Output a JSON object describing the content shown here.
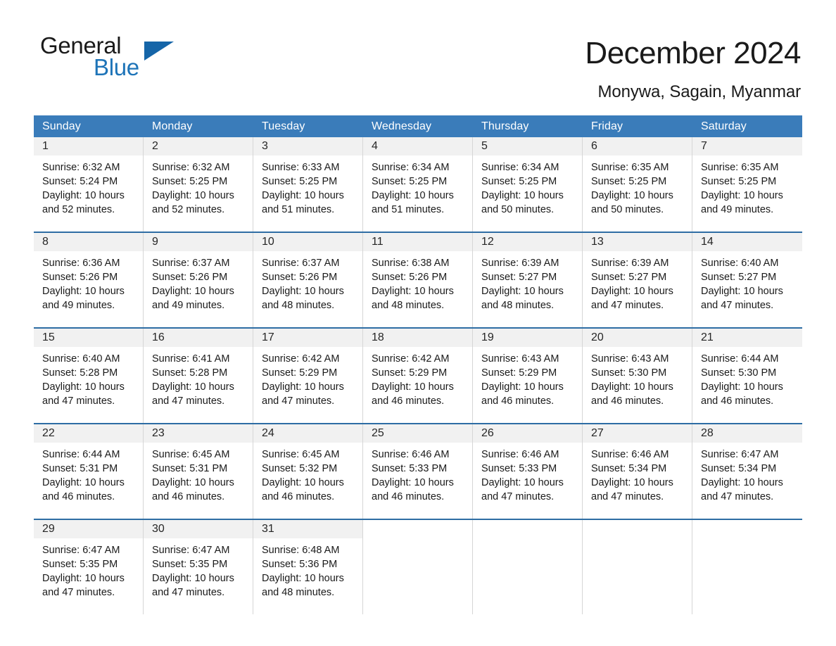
{
  "brand": {
    "name_part1": "General",
    "name_part2": "Blue",
    "triangle_color": "#1565a8",
    "blue_color": "#1e74b8"
  },
  "header": {
    "month_title": "December 2024",
    "location": "Monywa, Sagain, Myanmar"
  },
  "calendar": {
    "header_bg": "#3a7cba",
    "row_divider_color": "#2e6da4",
    "daynum_band_bg": "#f1f1f1",
    "weekdays": [
      "Sunday",
      "Monday",
      "Tuesday",
      "Wednesday",
      "Thursday",
      "Friday",
      "Saturday"
    ],
    "weeks": [
      [
        {
          "day": "1",
          "sunrise": "Sunrise: 6:32 AM",
          "sunset": "Sunset: 5:24 PM",
          "daylight_line1": "Daylight: 10 hours",
          "daylight_line2": "and 52 minutes."
        },
        {
          "day": "2",
          "sunrise": "Sunrise: 6:32 AM",
          "sunset": "Sunset: 5:25 PM",
          "daylight_line1": "Daylight: 10 hours",
          "daylight_line2": "and 52 minutes."
        },
        {
          "day": "3",
          "sunrise": "Sunrise: 6:33 AM",
          "sunset": "Sunset: 5:25 PM",
          "daylight_line1": "Daylight: 10 hours",
          "daylight_line2": "and 51 minutes."
        },
        {
          "day": "4",
          "sunrise": "Sunrise: 6:34 AM",
          "sunset": "Sunset: 5:25 PM",
          "daylight_line1": "Daylight: 10 hours",
          "daylight_line2": "and 51 minutes."
        },
        {
          "day": "5",
          "sunrise": "Sunrise: 6:34 AM",
          "sunset": "Sunset: 5:25 PM",
          "daylight_line1": "Daylight: 10 hours",
          "daylight_line2": "and 50 minutes."
        },
        {
          "day": "6",
          "sunrise": "Sunrise: 6:35 AM",
          "sunset": "Sunset: 5:25 PM",
          "daylight_line1": "Daylight: 10 hours",
          "daylight_line2": "and 50 minutes."
        },
        {
          "day": "7",
          "sunrise": "Sunrise: 6:35 AM",
          "sunset": "Sunset: 5:25 PM",
          "daylight_line1": "Daylight: 10 hours",
          "daylight_line2": "and 49 minutes."
        }
      ],
      [
        {
          "day": "8",
          "sunrise": "Sunrise: 6:36 AM",
          "sunset": "Sunset: 5:26 PM",
          "daylight_line1": "Daylight: 10 hours",
          "daylight_line2": "and 49 minutes."
        },
        {
          "day": "9",
          "sunrise": "Sunrise: 6:37 AM",
          "sunset": "Sunset: 5:26 PM",
          "daylight_line1": "Daylight: 10 hours",
          "daylight_line2": "and 49 minutes."
        },
        {
          "day": "10",
          "sunrise": "Sunrise: 6:37 AM",
          "sunset": "Sunset: 5:26 PM",
          "daylight_line1": "Daylight: 10 hours",
          "daylight_line2": "and 48 minutes."
        },
        {
          "day": "11",
          "sunrise": "Sunrise: 6:38 AM",
          "sunset": "Sunset: 5:26 PM",
          "daylight_line1": "Daylight: 10 hours",
          "daylight_line2": "and 48 minutes."
        },
        {
          "day": "12",
          "sunrise": "Sunrise: 6:39 AM",
          "sunset": "Sunset: 5:27 PM",
          "daylight_line1": "Daylight: 10 hours",
          "daylight_line2": "and 48 minutes."
        },
        {
          "day": "13",
          "sunrise": "Sunrise: 6:39 AM",
          "sunset": "Sunset: 5:27 PM",
          "daylight_line1": "Daylight: 10 hours",
          "daylight_line2": "and 47 minutes."
        },
        {
          "day": "14",
          "sunrise": "Sunrise: 6:40 AM",
          "sunset": "Sunset: 5:27 PM",
          "daylight_line1": "Daylight: 10 hours",
          "daylight_line2": "and 47 minutes."
        }
      ],
      [
        {
          "day": "15",
          "sunrise": "Sunrise: 6:40 AM",
          "sunset": "Sunset: 5:28 PM",
          "daylight_line1": "Daylight: 10 hours",
          "daylight_line2": "and 47 minutes."
        },
        {
          "day": "16",
          "sunrise": "Sunrise: 6:41 AM",
          "sunset": "Sunset: 5:28 PM",
          "daylight_line1": "Daylight: 10 hours",
          "daylight_line2": "and 47 minutes."
        },
        {
          "day": "17",
          "sunrise": "Sunrise: 6:42 AM",
          "sunset": "Sunset: 5:29 PM",
          "daylight_line1": "Daylight: 10 hours",
          "daylight_line2": "and 47 minutes."
        },
        {
          "day": "18",
          "sunrise": "Sunrise: 6:42 AM",
          "sunset": "Sunset: 5:29 PM",
          "daylight_line1": "Daylight: 10 hours",
          "daylight_line2": "and 46 minutes."
        },
        {
          "day": "19",
          "sunrise": "Sunrise: 6:43 AM",
          "sunset": "Sunset: 5:29 PM",
          "daylight_line1": "Daylight: 10 hours",
          "daylight_line2": "and 46 minutes."
        },
        {
          "day": "20",
          "sunrise": "Sunrise: 6:43 AM",
          "sunset": "Sunset: 5:30 PM",
          "daylight_line1": "Daylight: 10 hours",
          "daylight_line2": "and 46 minutes."
        },
        {
          "day": "21",
          "sunrise": "Sunrise: 6:44 AM",
          "sunset": "Sunset: 5:30 PM",
          "daylight_line1": "Daylight: 10 hours",
          "daylight_line2": "and 46 minutes."
        }
      ],
      [
        {
          "day": "22",
          "sunrise": "Sunrise: 6:44 AM",
          "sunset": "Sunset: 5:31 PM",
          "daylight_line1": "Daylight: 10 hours",
          "daylight_line2": "and 46 minutes."
        },
        {
          "day": "23",
          "sunrise": "Sunrise: 6:45 AM",
          "sunset": "Sunset: 5:31 PM",
          "daylight_line1": "Daylight: 10 hours",
          "daylight_line2": "and 46 minutes."
        },
        {
          "day": "24",
          "sunrise": "Sunrise: 6:45 AM",
          "sunset": "Sunset: 5:32 PM",
          "daylight_line1": "Daylight: 10 hours",
          "daylight_line2": "and 46 minutes."
        },
        {
          "day": "25",
          "sunrise": "Sunrise: 6:46 AM",
          "sunset": "Sunset: 5:33 PM",
          "daylight_line1": "Daylight: 10 hours",
          "daylight_line2": "and 46 minutes."
        },
        {
          "day": "26",
          "sunrise": "Sunrise: 6:46 AM",
          "sunset": "Sunset: 5:33 PM",
          "daylight_line1": "Daylight: 10 hours",
          "daylight_line2": "and 47 minutes."
        },
        {
          "day": "27",
          "sunrise": "Sunrise: 6:46 AM",
          "sunset": "Sunset: 5:34 PM",
          "daylight_line1": "Daylight: 10 hours",
          "daylight_line2": "and 47 minutes."
        },
        {
          "day": "28",
          "sunrise": "Sunrise: 6:47 AM",
          "sunset": "Sunset: 5:34 PM",
          "daylight_line1": "Daylight: 10 hours",
          "daylight_line2": "and 47 minutes."
        }
      ],
      [
        {
          "day": "29",
          "sunrise": "Sunrise: 6:47 AM",
          "sunset": "Sunset: 5:35 PM",
          "daylight_line1": "Daylight: 10 hours",
          "daylight_line2": "and 47 minutes."
        },
        {
          "day": "30",
          "sunrise": "Sunrise: 6:47 AM",
          "sunset": "Sunset: 5:35 PM",
          "daylight_line1": "Daylight: 10 hours",
          "daylight_line2": "and 47 minutes."
        },
        {
          "day": "31",
          "sunrise": "Sunrise: 6:48 AM",
          "sunset": "Sunset: 5:36 PM",
          "daylight_line1": "Daylight: 10 hours",
          "daylight_line2": "and 48 minutes."
        },
        {
          "day": "",
          "sunrise": "",
          "sunset": "",
          "daylight_line1": "",
          "daylight_line2": ""
        },
        {
          "day": "",
          "sunrise": "",
          "sunset": "",
          "daylight_line1": "",
          "daylight_line2": ""
        },
        {
          "day": "",
          "sunrise": "",
          "sunset": "",
          "daylight_line1": "",
          "daylight_line2": ""
        },
        {
          "day": "",
          "sunrise": "",
          "sunset": "",
          "daylight_line1": "",
          "daylight_line2": ""
        }
      ]
    ]
  }
}
